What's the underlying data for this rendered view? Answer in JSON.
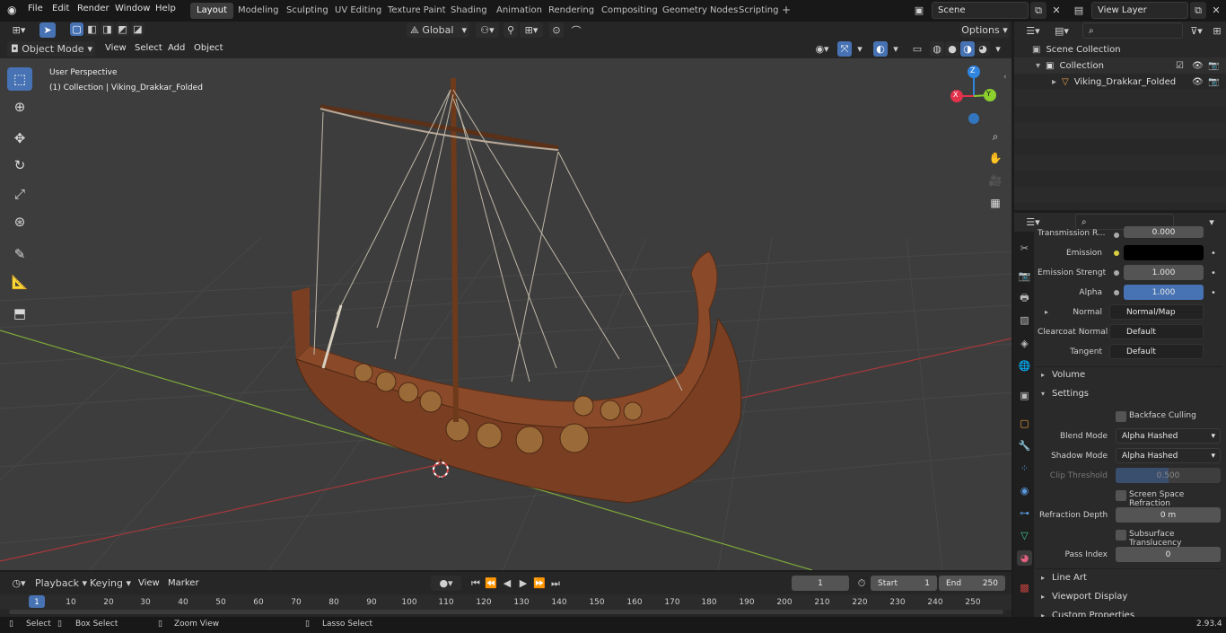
{
  "topbar": {
    "menus": [
      "File",
      "Edit",
      "Render",
      "Window",
      "Help"
    ],
    "workspaces": [
      "Layout",
      "Modeling",
      "Sculpting",
      "UV Editing",
      "Texture Paint",
      "Shading",
      "Animation",
      "Rendering",
      "Compositing",
      "Geometry Nodes",
      "Scripting"
    ],
    "active_workspace": "Layout",
    "add_tab": "+",
    "scene": "Scene",
    "view_layer": "View Layer"
  },
  "viewport_header": {
    "mode": "Object Mode",
    "menus": [
      "View",
      "Select",
      "Add",
      "Object"
    ],
    "transform": "Global",
    "options": "Options"
  },
  "viewport": {
    "perspective": "User Perspective",
    "collection_info": "(1) Collection | Viking_Drakkar_Folded",
    "gizmo": {
      "x": "X",
      "y": "Y",
      "z": "Z"
    }
  },
  "outliner": {
    "scene_collection": "Scene Collection",
    "collection": "Collection",
    "object": "Viking_Drakkar_Folded"
  },
  "properties": {
    "partial_label": "Transmission R...",
    "partial_value": "0.000",
    "emission": "Emission",
    "emission_strength_label": "Emission Strengt",
    "emission_strength": "1.000",
    "alpha_label": "Alpha",
    "alpha": "1.000",
    "normal_label": "Normal",
    "normal": "Normal/Map",
    "clearcoat_label": "Clearcoat Normal",
    "clearcoat": "Default",
    "tangent_label": "Tangent",
    "tangent": "Default",
    "volume": "Volume",
    "settings": "Settings",
    "backface": "Backface Culling",
    "blend_label": "Blend Mode",
    "blend": "Alpha Hashed",
    "shadow_label": "Shadow Mode",
    "shadow": "Alpha Hashed",
    "clip_label": "Clip Threshold",
    "clip": "0.500",
    "ssr": "Screen Space Refraction",
    "refr_label": "Refraction Depth",
    "refr": "0 m",
    "sss": "Subsurface Translucency",
    "pass_label": "Pass Index",
    "pass": "0",
    "line_art": "Line Art",
    "viewport_display": "Viewport Display",
    "custom_props": "Custom Properties"
  },
  "timeline": {
    "menus": [
      "Playback",
      "Keying",
      "View",
      "Marker"
    ],
    "frame": "1",
    "start_label": "Start",
    "start": "1",
    "end_label": "End",
    "end": "250",
    "ticks": [
      "1",
      "10",
      "20",
      "30",
      "40",
      "50",
      "60",
      "70",
      "80",
      "90",
      "100",
      "110",
      "120",
      "130",
      "140",
      "150",
      "160",
      "170",
      "180",
      "190",
      "200",
      "210",
      "220",
      "230",
      "240",
      "250"
    ]
  },
  "status": {
    "select": "Select",
    "box_select": "Box Select",
    "zoom": "Zoom View",
    "lasso": "Lasso Select",
    "version": "2.93.4"
  },
  "colors": {
    "accent": "#4772b3",
    "x_axis": "#e2334b",
    "y_axis": "#8bd02e",
    "z_axis": "#2f85e0",
    "hull": "#8a4a2a"
  }
}
